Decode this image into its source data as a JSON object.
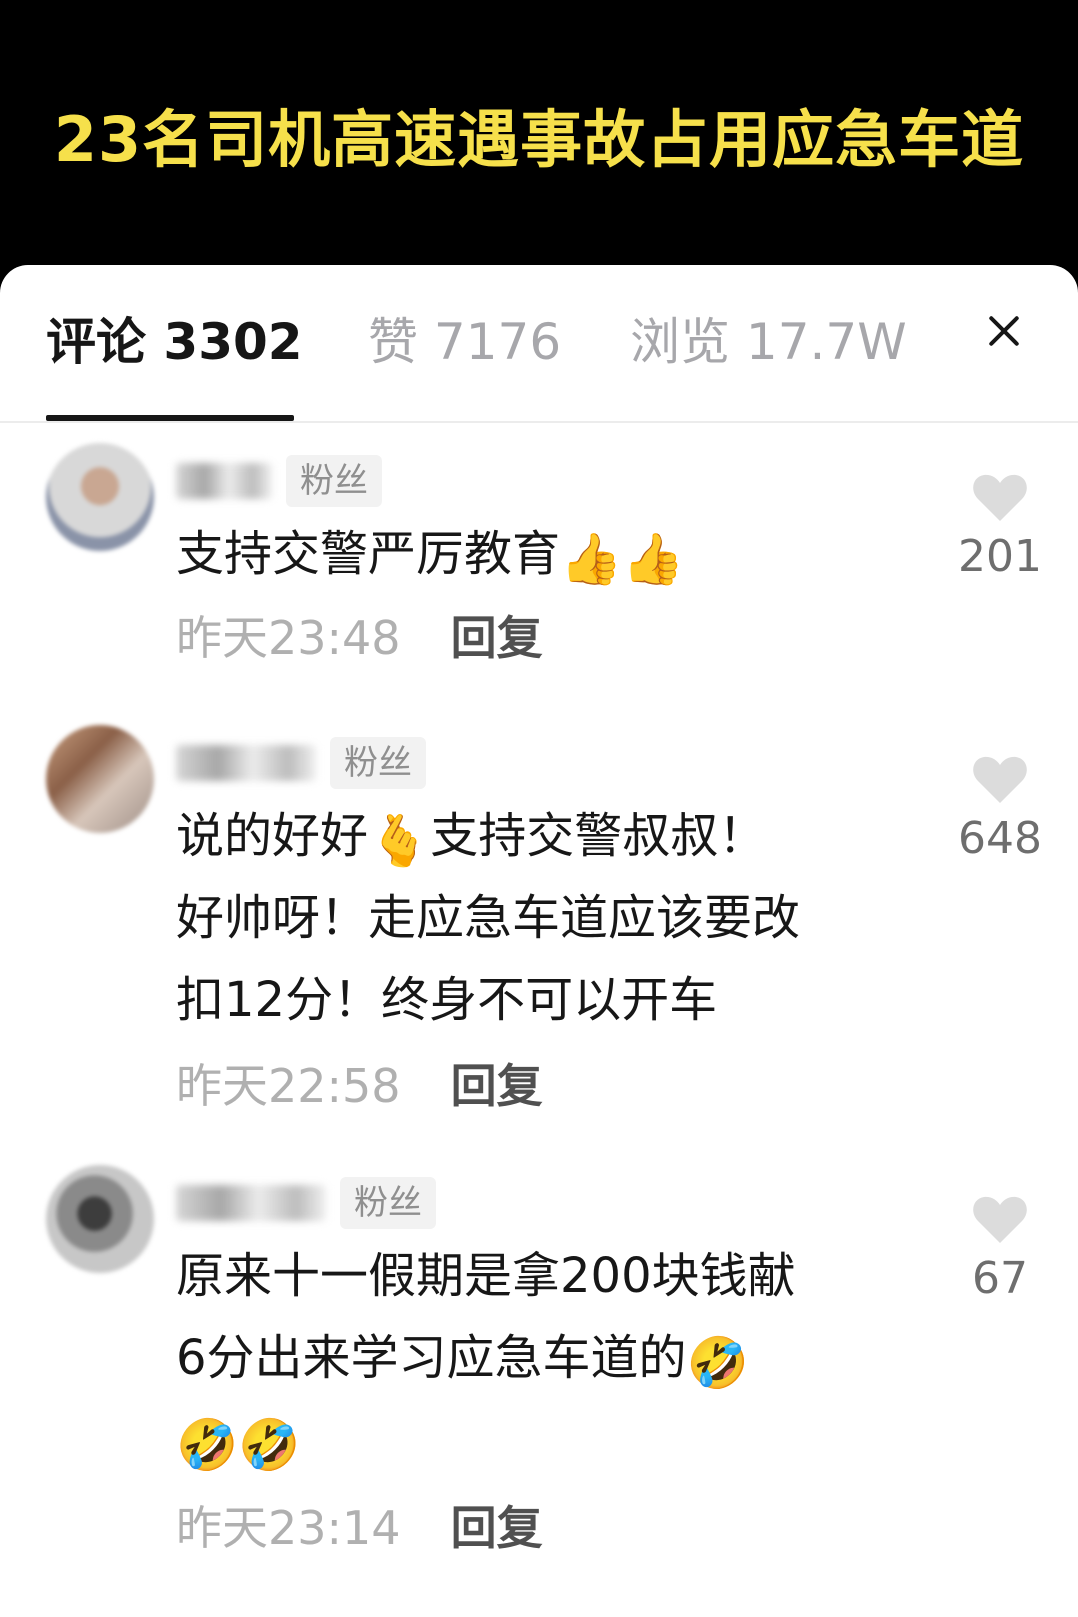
{
  "video": {
    "title": "23名司机高速遇事故占用应急车道"
  },
  "tabs": [
    {
      "label": "评论 3302",
      "active": true
    },
    {
      "label": "赞 7176",
      "active": false
    },
    {
      "label": "浏览 17.7W",
      "active": false
    }
  ],
  "comments": [
    {
      "badge": "粉丝",
      "text": "支持交警严厉教育",
      "emoji": "👍👍",
      "time": "昨天23:48",
      "reply": "回复",
      "likes": "201"
    },
    {
      "badge": "粉丝",
      "text_line1": "说的好好",
      "emoji": "🫰",
      "text_line1_rest": "支持交警叔叔！",
      "text_line2": "好帅呀！走应急车道应该要改",
      "text_line3": "扣12分！终身不可以开车",
      "time": "昨天22:58",
      "reply": "回复",
      "likes": "648"
    },
    {
      "badge": "粉丝",
      "text_line1": "原来十一假期是拿200块钱献",
      "text_line2": "6分出来学习应急车道的",
      "emoji_line2": "🤣",
      "emoji_line3": "🤣🤣",
      "time": "昨天23:14",
      "reply": "回复",
      "likes": "67"
    }
  ],
  "colors": {
    "title": "#f6e04b",
    "heart": "#dcdcdc",
    "badge_bg": "#f2f2f2"
  }
}
